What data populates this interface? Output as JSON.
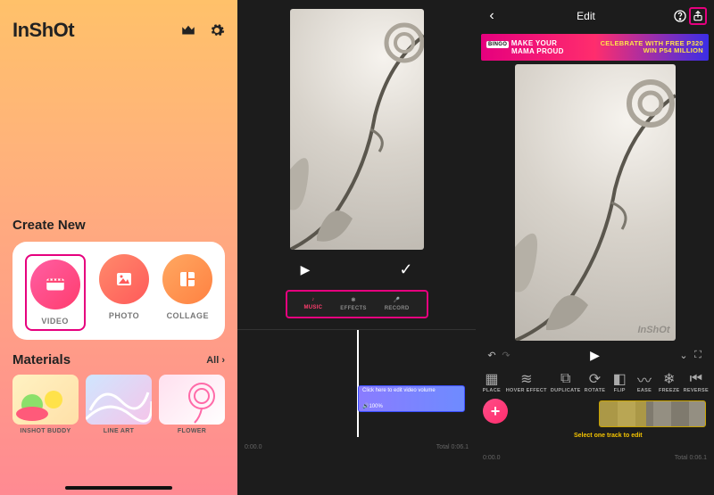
{
  "home": {
    "brand": "InShOt",
    "create_heading": "Create New",
    "tiles": {
      "video": "VIDEO",
      "photo": "PHOTO",
      "collage": "COLLAGE"
    },
    "materials_heading": "Materials",
    "materials_all": "All ›",
    "materials": [
      {
        "label": "INSHOT BUDDY"
      },
      {
        "label": "LINE ART"
      },
      {
        "label": "FLOWER"
      }
    ]
  },
  "editor_mid": {
    "tabs": {
      "music": "MUSIC",
      "effects": "EFFECTS",
      "record": "RECORD"
    },
    "vol_hint": "Click here to edit video volume",
    "vol_value": "🔊100%",
    "time_current": "0:00.0",
    "time_total": "Total 0:06.1"
  },
  "editor_right": {
    "header_title": "Edit",
    "ad_left_l1": "MAKE YOUR",
    "ad_left_l2": "MAMA PROUD",
    "ad_right_l1": "CELEBRATE WITH FREE P320",
    "ad_right_l2": "WIN P54 MILLION",
    "watermark": "InShOt",
    "tools": [
      {
        "id": "place",
        "label": "PLACE"
      },
      {
        "id": "hover-effect",
        "label": "HOVER EFFECT"
      },
      {
        "id": "duplicate",
        "label": "DUPLICATE"
      },
      {
        "id": "rotate",
        "label": "ROTATE"
      },
      {
        "id": "flip",
        "label": "FLIP"
      },
      {
        "id": "ease",
        "label": "EASE"
      },
      {
        "id": "freeze",
        "label": "FREEZE"
      },
      {
        "id": "reverse",
        "label": "REVERSE"
      }
    ],
    "select_hint": "Select one track to edit",
    "time_current": "0:00.0",
    "time_total": "Total 0:06.1"
  }
}
